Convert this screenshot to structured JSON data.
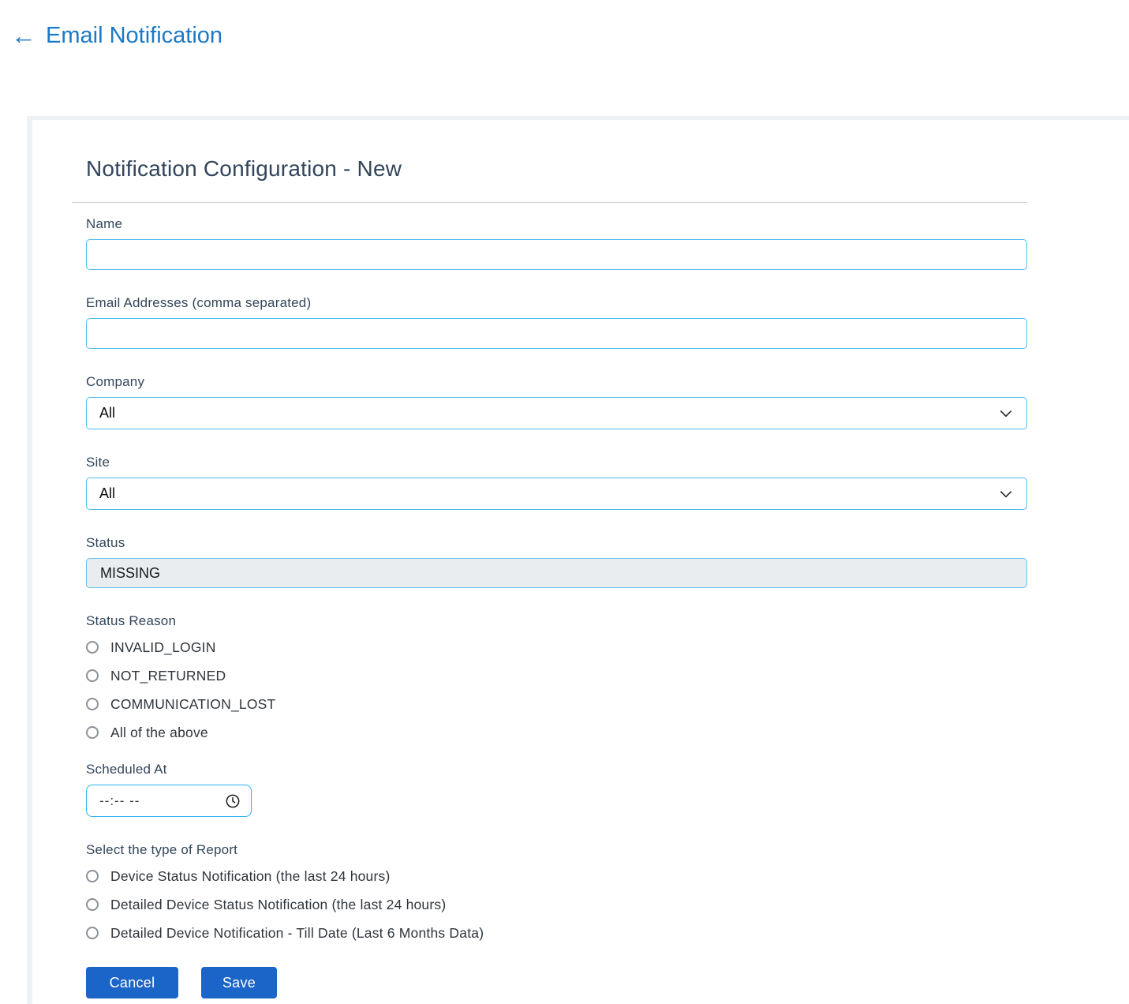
{
  "page": {
    "back_arrow": "←",
    "title": "Email Notification"
  },
  "form": {
    "heading": "Notification Configuration - New",
    "fields": {
      "name": {
        "label": "Name",
        "value": ""
      },
      "email": {
        "label": "Email Addresses (comma separated)",
        "value": ""
      },
      "company": {
        "label": "Company",
        "selected": "All"
      },
      "site": {
        "label": "Site",
        "selected": "All"
      },
      "status": {
        "label": "Status",
        "value": "MISSING"
      },
      "status_reason": {
        "label": "Status Reason",
        "options": [
          "INVALID_LOGIN",
          "NOT_RETURNED",
          "COMMUNICATION_LOST",
          "All of the above"
        ]
      },
      "scheduled_at": {
        "label": "Scheduled At",
        "placeholder": "--:-- --"
      },
      "report_type": {
        "label": "Select the type of Report",
        "options": [
          "Device Status Notification (the last 24 hours)",
          "Detailed Device Status Notification (the last 24 hours)",
          "Detailed Device Notification - Till Date (Last 6 Months Data)"
        ]
      }
    },
    "buttons": {
      "cancel": "Cancel",
      "save": "Save"
    }
  },
  "colors": {
    "link_blue": "#1b79c7",
    "heading_slate": "#32455c",
    "input_border_blue": "#4fbeec",
    "time_border_blue": "#2cb2ee",
    "button_blue": "#1b65c9",
    "status_disabled_bg": "#e9edf0",
    "frame_gray": "#eef2f6"
  }
}
